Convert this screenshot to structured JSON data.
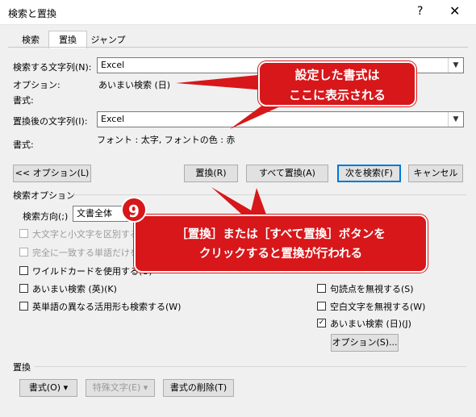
{
  "window": {
    "title": "検索と置換",
    "help": "?",
    "close": "✕"
  },
  "tabs": [
    "検索",
    "置換",
    "ジャンプ"
  ],
  "find": {
    "label": "検索する文字列(N):",
    "value": "Excel",
    "options_label": "オプション:",
    "options_value": "あいまい検索 (日)",
    "format_label": "書式:"
  },
  "replace": {
    "label": "置換後の文字列(I):",
    "value": "Excel",
    "format_label": "書式:",
    "format_value": "フォント : 太字, フォントの色 : 赤"
  },
  "buttons": {
    "options": "<< オプション(L)",
    "replace": "置換(R)",
    "replace_all": "すべて置換(A)",
    "find_next": "次を検索(F)",
    "cancel": "キャンセル"
  },
  "search_options": {
    "heading": "検索オプション",
    "direction_label": "検索方向(;)",
    "direction_value": "文書全体",
    "left": [
      {
        "label": "大文字と小文字を区別する",
        "checked": false,
        "disabled": true
      },
      {
        "label": "完全に一致する単語だけを検索する",
        "checked": false,
        "disabled": true
      },
      {
        "label": "ワイルドカードを使用する(U)",
        "checked": false,
        "disabled": false
      },
      {
        "label": "あいまい検索 (英)(K)",
        "checked": false,
        "disabled": false
      },
      {
        "label": "英単語の異なる活用形も検索する(W)",
        "checked": false,
        "disabled": false
      }
    ],
    "right": [
      {
        "label": "句読点を無視する(S)",
        "checked": false
      },
      {
        "label": "空白文字を無視する(W)",
        "checked": false
      },
      {
        "label": "あいまい検索 (日)(J)",
        "checked": true
      }
    ],
    "options_button": "オプション(S)..."
  },
  "replace_section": {
    "heading": "置換",
    "format_button": "書式(O)",
    "special_button": "特殊文字(E)",
    "clear_format_button": "書式の削除(T)"
  },
  "callouts": {
    "top": "設定した書式は\nここに表示される",
    "bottom": "［置換］または［すべて置換］ボタンを\nクリックすると置換が行われる",
    "step_number": "9"
  },
  "colors": {
    "callout": "#d7171a",
    "default_button_border": "#0078d7"
  }
}
